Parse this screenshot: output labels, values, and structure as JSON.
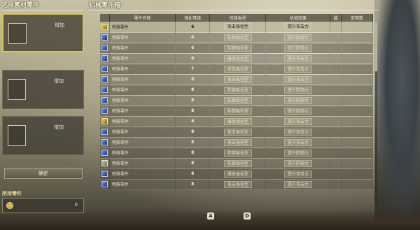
{
  "left_panel": {
    "title": "选择素材零件",
    "slots": [
      {
        "label": "增加"
      },
      {
        "label": "增加"
      },
      {
        "label": "增加"
      }
    ],
    "confirm_label": "确定",
    "materials_label": "所持零件",
    "materials_count": "0"
  },
  "main_panel": {
    "title": "机械零件箱",
    "columns": [
      "零件名称",
      "强化等级",
      "技能类型",
      "机械效果",
      "装",
      "使用数"
    ],
    "rows": [
      {
        "icon": "gold",
        "name": "特殊零件",
        "level": "6",
        "type": "攻击强化型",
        "effect": "提升攻击力",
        "equipped": "",
        "used": ""
      },
      {
        "icon": "blue",
        "name": "特殊零件",
        "level": "6",
        "type": "防御强化型",
        "effect": "提升防御力",
        "equipped": "",
        "used": ""
      },
      {
        "icon": "blue",
        "name": "特殊零件",
        "level": "6",
        "type": "防御强化型",
        "effect": "提升防御力",
        "equipped": "",
        "used": ""
      },
      {
        "icon": "blue",
        "name": "特殊零件",
        "level": "6",
        "type": "爆发强化型",
        "effect": "提升攻击力",
        "equipped": "",
        "used": ""
      },
      {
        "icon": "blue",
        "name": "特殊零件",
        "level": "7",
        "type": "攻击强化型",
        "effect": "提升攻击力",
        "equipped": "",
        "used": ""
      },
      {
        "icon": "blue",
        "name": "特殊零件",
        "level": "8",
        "type": "攻击强化型",
        "effect": "提升攻击力",
        "equipped": "",
        "used": ""
      },
      {
        "icon": "blue",
        "name": "特殊零件",
        "level": "8",
        "type": "防御强化型",
        "effect": "提升防御力",
        "equipped": "",
        "used": ""
      },
      {
        "icon": "blue",
        "name": "特殊零件",
        "level": "8",
        "type": "防御强化型",
        "effect": "提升防御力",
        "equipped": "",
        "used": ""
      },
      {
        "icon": "blue",
        "name": "特殊零件",
        "level": "8",
        "type": "防御强化型",
        "effect": "提升防御力",
        "equipped": "",
        "used": ""
      },
      {
        "icon": "gold",
        "name": "特殊零件",
        "level": "8",
        "type": "爆发强化型",
        "effect": "提升攻击力",
        "equipped": "",
        "used": ""
      },
      {
        "icon": "blue",
        "name": "特殊零件",
        "level": "8",
        "type": "攻击强化型",
        "effect": "提升攻击力",
        "equipped": "",
        "used": ""
      },
      {
        "icon": "blue",
        "name": "特殊零件",
        "level": "8",
        "type": "攻击强化型",
        "effect": "提升攻击力",
        "equipped": "",
        "used": ""
      },
      {
        "icon": "blue",
        "name": "特殊零件",
        "level": "8",
        "type": "防御强化型",
        "effect": "提升防御力",
        "equipped": "",
        "used": ""
      },
      {
        "icon": "gray",
        "name": "特殊零件",
        "level": "8",
        "type": "防御强化型",
        "effect": "提升防御力",
        "equipped": "",
        "used": ""
      },
      {
        "icon": "blue",
        "name": "特殊零件",
        "level": "8",
        "type": "爆发强化型",
        "effect": "提升攻击力",
        "equipped": "",
        "used": ""
      },
      {
        "icon": "blue",
        "name": "特殊零件",
        "level": "8",
        "type": "攻击强化型",
        "effect": "提升攻击力",
        "equipped": "",
        "used": ""
      }
    ]
  },
  "hints": [
    {
      "key": "A",
      "text": ""
    },
    {
      "key": "D",
      "text": ""
    }
  ]
}
